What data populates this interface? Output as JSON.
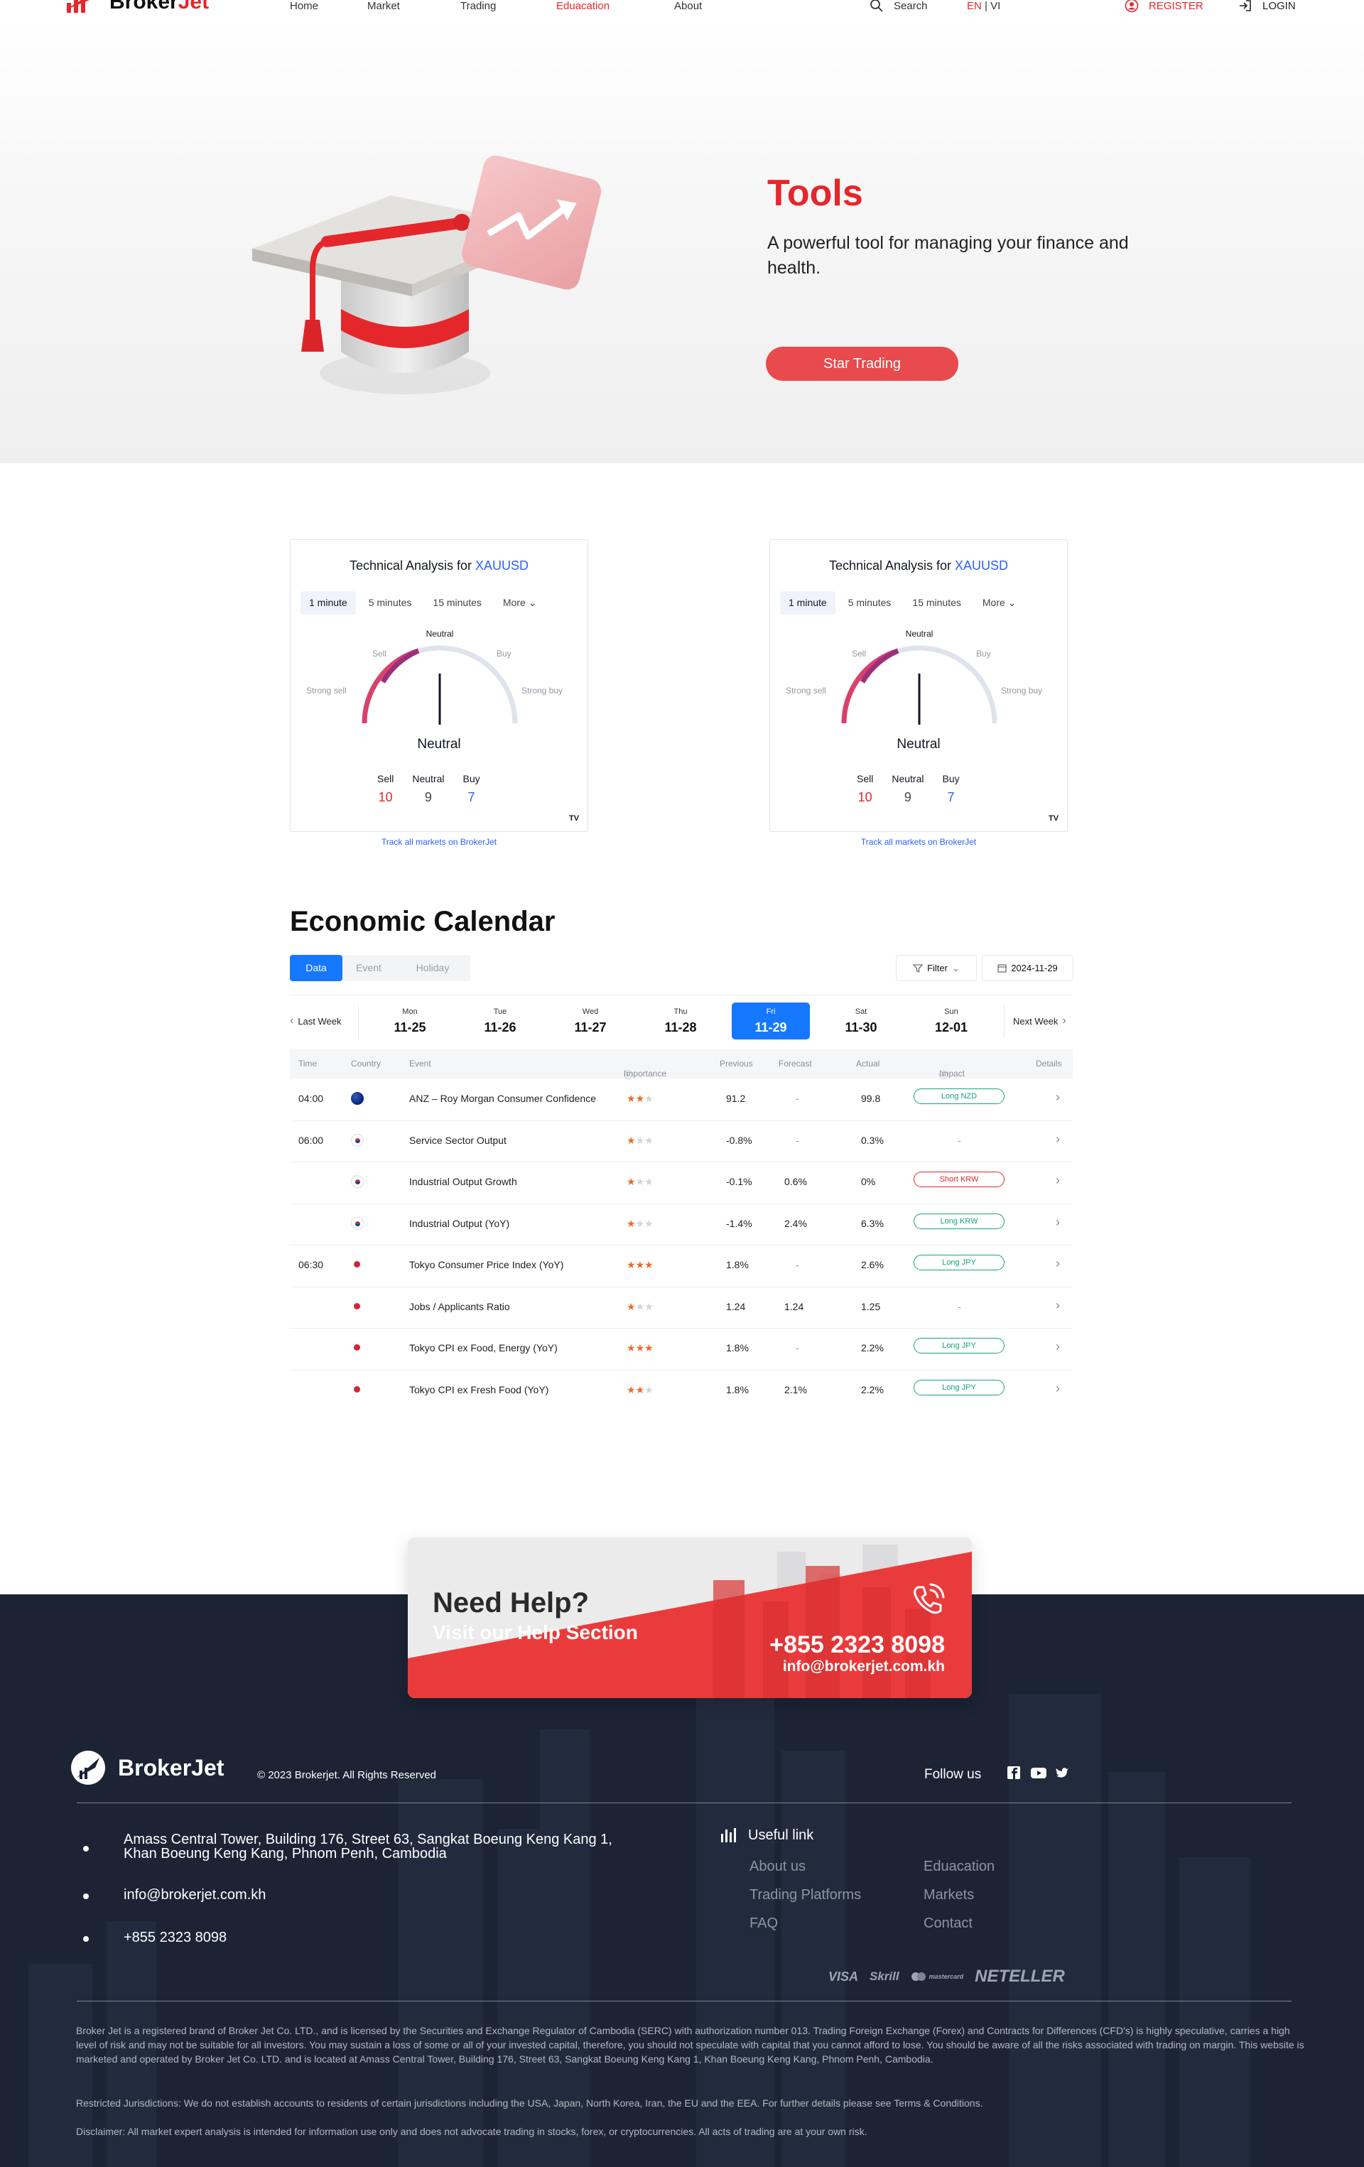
{
  "nav": {
    "brand_prefix": "Broker",
    "brand_suffix": "Jet",
    "links": [
      "Home",
      "Market",
      "Trading",
      "Eduacation",
      "About"
    ],
    "search_label": "Search",
    "lang_active": "EN",
    "lang_sep": " | ",
    "lang_other": "VI",
    "register": "REGISTER",
    "login": "LOGIN"
  },
  "hero": {
    "title": "Tools",
    "subtitle": "A powerful tool for managing your finance and health.",
    "cta": "Star Trading"
  },
  "ta_widgets": [
    {
      "title": "Technical Analysis for ",
      "symbol": "XAUUSD",
      "tabs": [
        "1 minute",
        "5 minutes",
        "15 minutes",
        "More"
      ],
      "gauge_labels": {
        "neutral": "Neutral",
        "sell": "Sell",
        "buy": "Buy",
        "strong_sell": "Strong sell",
        "strong_buy": "Strong buy"
      },
      "summary": "Neutral",
      "counts": [
        {
          "label": "Sell",
          "value": "10"
        },
        {
          "label": "Neutral",
          "value": "9"
        },
        {
          "label": "Buy",
          "value": "7"
        }
      ],
      "link": "Track all markets on BrokerJet"
    },
    {
      "title": "Technical Analysis for ",
      "symbol": "XAUUSD",
      "tabs": [
        "1 minute",
        "5 minutes",
        "15 minutes",
        "More"
      ],
      "gauge_labels": {
        "neutral": "Neutral",
        "sell": "Sell",
        "buy": "Buy",
        "strong_sell": "Strong sell",
        "strong_buy": "Strong buy"
      },
      "summary": "Neutral",
      "counts": [
        {
          "label": "Sell",
          "value": "10"
        },
        {
          "label": "Neutral",
          "value": "9"
        },
        {
          "label": "Buy",
          "value": "7"
        }
      ],
      "link": "Track all markets on BrokerJet"
    }
  ],
  "calendar": {
    "title": "Economic Calendar",
    "tabs": [
      "Data",
      "Event",
      "Holiday"
    ],
    "filter": "Filter",
    "date": "2024-11-29",
    "last_week": "Last Week",
    "next_week": "Next Week",
    "days": [
      {
        "dow": "Mon",
        "date": "11-25"
      },
      {
        "dow": "Tue",
        "date": "11-26"
      },
      {
        "dow": "Wed",
        "date": "11-27"
      },
      {
        "dow": "Thu",
        "date": "11-28"
      },
      {
        "dow": "Fri",
        "date": "11-29"
      },
      {
        "dow": "Sat",
        "date": "11-30"
      },
      {
        "dow": "Sun",
        "date": "12-01"
      }
    ],
    "headers": {
      "time": "Time",
      "country": "Country",
      "event": "Event",
      "importance": "Importance",
      "previous": "Previous",
      "forecast": "Forecast",
      "actual": "Actual",
      "impact": "Impact",
      "details": "Details"
    },
    "rows": [
      {
        "time": "04:00",
        "flag": "au",
        "event": "ANZ – Roy Morgan Consumer Confidence",
        "stars": 2,
        "previous": "91.2",
        "forecast": "-",
        "actual": "99.8",
        "impact": "Long NZD",
        "impact_type": "long"
      },
      {
        "time": "06:00",
        "flag": "kr",
        "event": "Service Sector Output",
        "stars": 1,
        "previous": "-0.8%",
        "forecast": "-",
        "actual": "0.3%",
        "impact": "-",
        "impact_type": "none"
      },
      {
        "time": "",
        "flag": "kr",
        "event": "Industrial Output Growth",
        "stars": 1,
        "previous": "-0.1%",
        "forecast": "0.6%",
        "actual": "0%",
        "impact": "Short KRW",
        "impact_type": "short"
      },
      {
        "time": "",
        "flag": "kr",
        "event": "Industrial Output (YoY)",
        "stars": 1,
        "previous": "-1.4%",
        "forecast": "2.4%",
        "actual": "6.3%",
        "impact": "Long KRW",
        "impact_type": "long"
      },
      {
        "time": "06:30",
        "flag": "jp",
        "event": "Tokyo Consumer Price Index (YoY)",
        "stars": 3,
        "previous": "1.8%",
        "forecast": "-",
        "actual": "2.6%",
        "impact": "Long JPY",
        "impact_type": "long"
      },
      {
        "time": "",
        "flag": "jp",
        "event": "Jobs / Applicants Ratio",
        "stars": 1,
        "previous": "1.24",
        "forecast": "1.24",
        "actual": "1.25",
        "impact": "-",
        "impact_type": "none"
      },
      {
        "time": "",
        "flag": "jp",
        "event": "Tokyo CPI ex Food, Energy (YoY)",
        "stars": 3,
        "previous": "1.8%",
        "forecast": "-",
        "actual": "2.2%",
        "impact": "Long JPY",
        "impact_type": "long"
      },
      {
        "time": "",
        "flag": "jp",
        "event": "Tokyo CPI ex Fresh Food (YoY)",
        "stars": 2,
        "previous": "1.8%",
        "forecast": "2.1%",
        "actual": "2.2%",
        "impact": "Long JPY",
        "impact_type": "long"
      }
    ]
  },
  "help": {
    "title": "Need Help?",
    "subtitle": "Visit our Help Section",
    "phone": "+855 2323 8098",
    "email": "info@brokerjet.com.kh"
  },
  "footer": {
    "brand": "BrokerJet",
    "copyright": "© 2023 Brokerjet. All Rights Reserved",
    "follow": "Follow us",
    "address_line1": "Amass Central Tower, Building 176, Street 63, Sangkat Boeung Keng Kang 1,",
    "address_line2": "Khan Boeung Keng Kang, Phnom Penh, Cambodia",
    "email": "info@brokerjet.com.kh",
    "phone": "+855 2323 8098",
    "useful_title": "Useful link",
    "links_col1": [
      "About us",
      "Trading Platforms",
      "FAQ"
    ],
    "links_col2": [
      "Eduacation",
      "Markets",
      "Contact"
    ],
    "payments": [
      "VISA",
      "Skrill",
      "mastercard",
      "NETELLER"
    ],
    "legal": [
      "Broker Jet is a registered brand of Broker Jet Co. LTD., and is licensed by the Securities and Exchange Regulator of Cambodia (SERC) with authorization number 013. Trading Foreign Exchange (Forex) and Contracts for Differences (CFD's) is highly speculative, carries a high level of risk and may not be suitable for all investors. You may sustain a loss of some or all of your invested capital, therefore, you should not speculate with capital that you cannot afford to lose. You should be aware of all the risks associated with trading on margin. This website is marketed and operated by Broker Jet Co. LTD. and is located at Amass Central Tower, Building 176, Street 63, Sangkat Boeung Keng Kang 1, Khan Boeung Keng Kang, Phnom Penh, Cambodia.",
      "Restricted Jurisdictions: We do not establish accounts to residents of certain jurisdictions including the USA, Japan, North Korea, Iran, the EU and the EEA. For further details please see Terms & Conditions.",
      "Disclaimer: All market expert analysis is intended for information use only and does not advocate trading in stocks, forex, or cryptocurrencies. All acts of trading are at your own risk."
    ]
  },
  "colors": {
    "accent": "#e5262b",
    "blue": "#1677ff",
    "footer_bg": "#1b2334",
    "long": "#16a37b"
  }
}
